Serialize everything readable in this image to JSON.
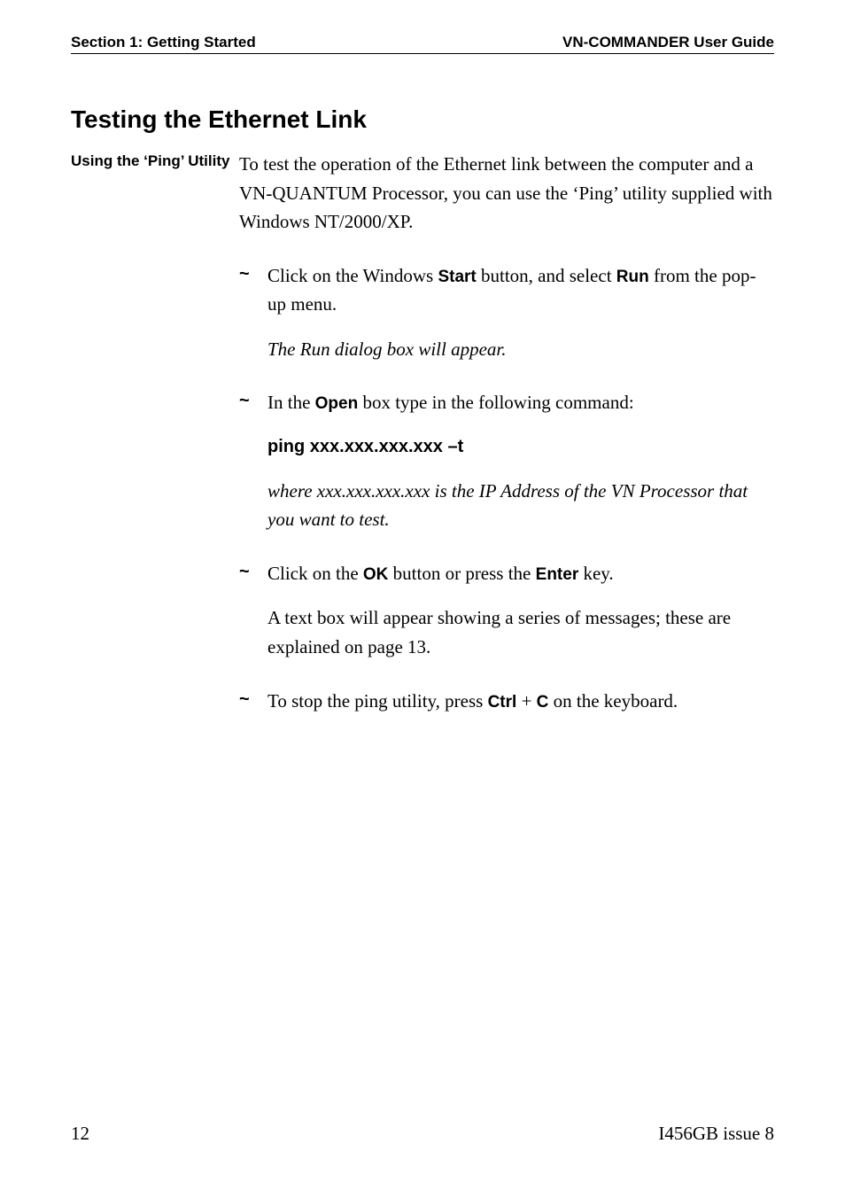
{
  "header": {
    "left": "Section 1: Getting Started",
    "right": "VN-COMMANDER User Guide"
  },
  "title": "Testing the Ethernet Link",
  "side_label": "Using the ‘Ping’ Utility",
  "intro": "To test the operation of the Ethernet link between the computer and a VN-QUANTUM Processor, you can use the ‘Ping’ utility supplied with Windows NT/2000/XP.",
  "steps": {
    "s1": {
      "pre1": "Click on the Windows ",
      "b1": "Start",
      "mid1": " button, and select ",
      "b2": "Run",
      "post1": " from the pop-up menu.",
      "note": "The Run dialog box will appear."
    },
    "s2": {
      "pre1": "In the ",
      "b1": "Open",
      "post1": " box type in the following command:",
      "cmd": "ping xxx.xxx.xxx.xxx –t",
      "note": "where xxx.xxx.xxx.xxx is the IP Address of the VN Processor that you want to test."
    },
    "s3": {
      "pre1": "Click on the ",
      "b1": "OK",
      "mid1": " button or press the ",
      "b2": "Enter",
      "post1": " key.",
      "note": "A text box will appear showing a series of messages; these are explained on page 13."
    },
    "s4": {
      "pre1": "To stop the ping utility, press ",
      "b1": "Ctrl",
      "mid1": " + ",
      "b2": "C",
      "post1": " on the keyboard."
    }
  },
  "footer": {
    "page": "12",
    "issue": "I456GB issue 8"
  }
}
